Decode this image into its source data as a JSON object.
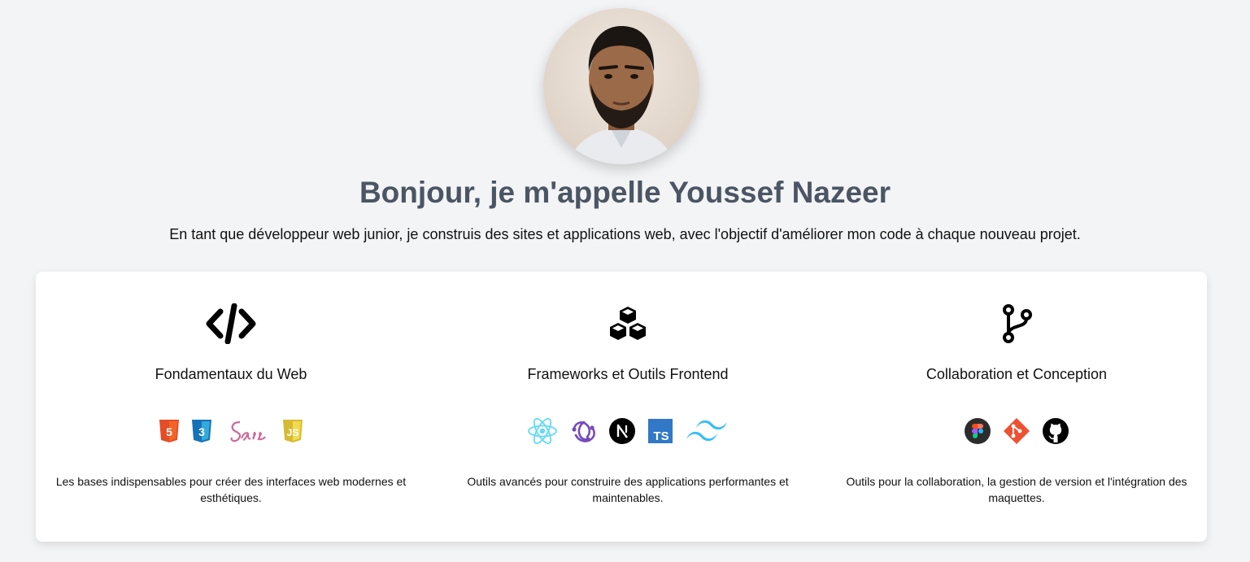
{
  "hero": {
    "title": "Bonjour, je m'appelle Youssef Nazeer",
    "subtitle": "En tant que développeur web junior, je construis des sites et applications web, avec l'objectif d'améliorer mon code à chaque nouveau projet."
  },
  "skills": [
    {
      "icon": "code-icon",
      "title": "Fondamentaux du Web",
      "tools": [
        "html5-icon",
        "css3-icon",
        "sass-icon",
        "javascript-icon"
      ],
      "description": "Les bases indispensables pour créer des interfaces web modernes et esthétiques."
    },
    {
      "icon": "cubes-icon",
      "title": "Frameworks et Outils Frontend",
      "tools": [
        "react-icon",
        "redux-icon",
        "nextjs-icon",
        "typescript-icon",
        "tailwind-icon"
      ],
      "description": "Outils avancés pour construire des applications performantes et maintenables."
    },
    {
      "icon": "code-branch-icon",
      "title": "Collaboration et Conception",
      "tools": [
        "figma-icon",
        "git-icon",
        "github-icon"
      ],
      "description": "Outils pour la collaboration, la gestion de version et l'intégration des maquettes."
    }
  ],
  "colors": {
    "background": "#f3f4f6",
    "title": "#4b5563",
    "card": "#ffffff",
    "html5": "#e44d26",
    "css3": "#1572b6",
    "sass": "#cd6799",
    "javascript": "#d6ba32",
    "react": "#61dafb",
    "redux": "#764abc",
    "typescript": "#3178c6",
    "tailwind": "#38bdf8",
    "git": "#f05032"
  }
}
